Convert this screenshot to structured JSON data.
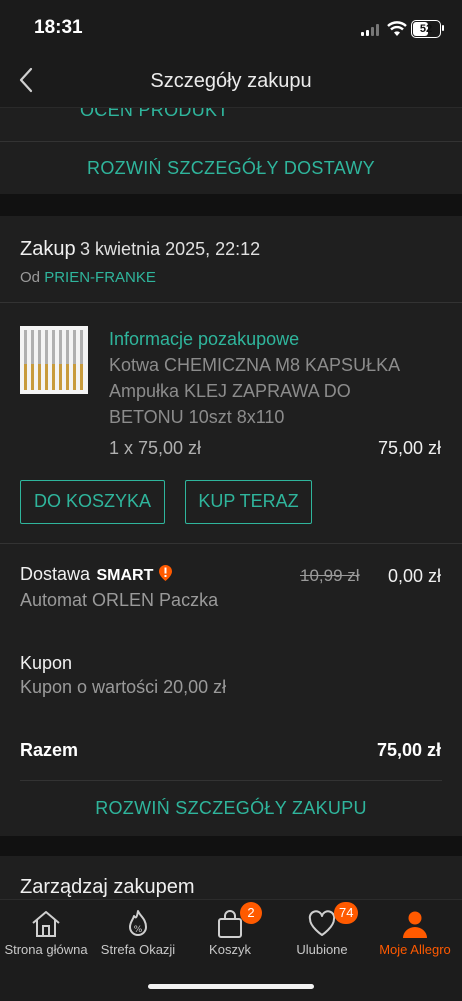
{
  "status_bar": {
    "time": "18:31",
    "battery": "52"
  },
  "header": {
    "title": "Szczegóły zakupu"
  },
  "top_card": {
    "rate_link": "OCEŃ PRODUKT",
    "expand_delivery": "ROZWIŃ SZCZEGÓŁY DOSTAWY"
  },
  "purchase": {
    "label": "Zakup",
    "date": "3 kwietnia 2025, 22:12",
    "seller_prefix": "Od",
    "seller": "PRIEN-FRANKE",
    "item": {
      "info_link": "Informacje pozakupowe",
      "name_line1": "Kotwa CHEMICZNA M8 KAPSUŁKA",
      "name_line2": "Ampułka KLEJ ZAPRAWA DO",
      "name_line3": "BETONU 10szt 8x110",
      "quantity_price": "1 x 75,00 zł",
      "total": "75,00 zł"
    },
    "add_to_cart_label": "DO KOSZYKA",
    "buy_now_label": "KUP TERAZ",
    "delivery": {
      "label": "Dostawa",
      "smart_label": "SMART",
      "old_price": "10,99 zł",
      "price": "0,00 zł",
      "method": "Automat ORLEN Paczka"
    },
    "coupon": {
      "label": "Kupon",
      "description": "Kupon o wartości 20,00 zł"
    },
    "sum": {
      "label": "Razem",
      "value": "75,00 zł"
    },
    "expand_purchase": "ROZWIŃ SZCZEGÓŁY ZAKUPU"
  },
  "manage": {
    "title": "Zarządzaj zakupem"
  },
  "bottom_nav": {
    "items": [
      {
        "label": "Strona główna",
        "icon": "home-icon"
      },
      {
        "label": "Strefa Okazji",
        "icon": "percent-flame-icon"
      },
      {
        "label": "Koszyk",
        "icon": "bag-icon",
        "badge": "2"
      },
      {
        "label": "Ulubione",
        "icon": "heart-icon",
        "badge": "74"
      },
      {
        "label": "Moje Allegro",
        "icon": "user-icon",
        "active": true
      }
    ]
  },
  "colors": {
    "accent": "#2fb59c",
    "brand": "#ff5a00",
    "background": "#111111",
    "card": "#1f1f1f"
  }
}
